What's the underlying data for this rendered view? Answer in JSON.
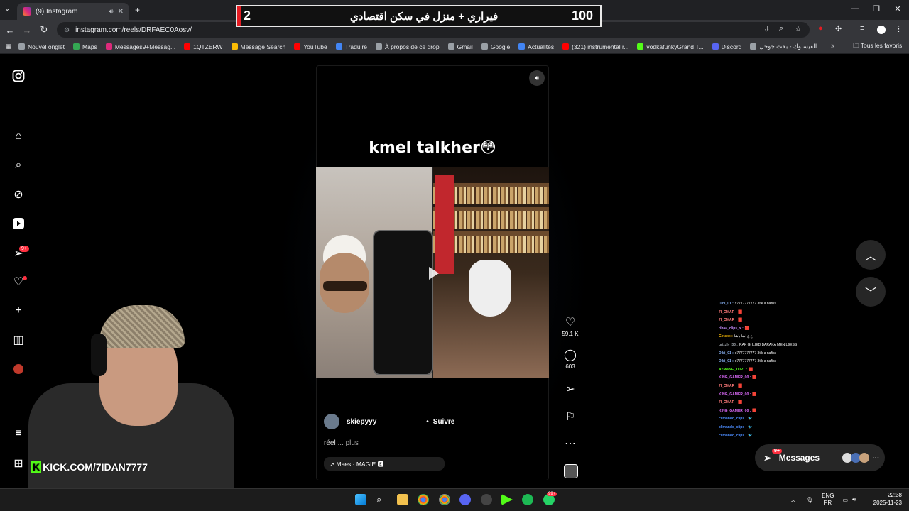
{
  "browser": {
    "tab_title": "(9) Instagram",
    "url": "instagram.com/reels/DRFAEC0Aosv/",
    "bookmarks": [
      {
        "label": "Nouvel onglet",
        "color": "#9aa0a6"
      },
      {
        "label": "Maps",
        "color": "#34a853"
      },
      {
        "label": "Messages9+Messag...",
        "color": "#dd2a7b"
      },
      {
        "label": "1QTZERW",
        "color": "#ff0000"
      },
      {
        "label": "Message Search",
        "color": "#fbbc04"
      },
      {
        "label": "YouTube",
        "color": "#ff0000"
      },
      {
        "label": "Traduire",
        "color": "#4285f4"
      },
      {
        "label": "À propos de ce drop",
        "color": "#9aa0a6"
      },
      {
        "label": "Gmail",
        "color": "#9aa0a6"
      },
      {
        "label": "Google",
        "color": "#9aa0a6"
      },
      {
        "label": "Actualités",
        "color": "#4285f4"
      },
      {
        "label": "(321) instrumental r...",
        "color": "#ff0000"
      },
      {
        "label": "vodkafunkyGrand T...",
        "color": "#53fc18"
      },
      {
        "label": "Discord",
        "color": "#5865f2"
      },
      {
        "label": "الفيسبوك - بحث جوجل",
        "color": "#9aa0a6"
      }
    ],
    "all_bookmarks": "Tous les favoris"
  },
  "banner": {
    "left_number": "2",
    "title": "فيراري + منزل في سكن اقتصادي",
    "right_number": "100"
  },
  "sidebar": {
    "notifications_badge": "9+"
  },
  "reel": {
    "caption": "kmel talkher😳",
    "likes": "59,1 K",
    "comments": "603",
    "username": "skiepyyy",
    "follow": "Suivre",
    "dot": "•",
    "desc": "réel",
    "more": "... plus",
    "music": "↗ Maes · MAGIE 🅴"
  },
  "chat": [
    {
      "user": "Dibi_01 :",
      "msg": "x7777777777 3tik a nafiss",
      "color": "#8ab4f8"
    },
    {
      "user": "7I_OMAR :",
      "msg": "🟥",
      "color": "#ff7b7b"
    },
    {
      "user": "7I_OMAR :",
      "msg": "🟥",
      "color": "#ff7b7b"
    },
    {
      "user": "rihaa_clips_x :",
      "msg": "🟥",
      "color": "#c58af9"
    },
    {
      "user": "Getaxx :",
      "msg": "ع ع اشا باشا",
      "color": "#fbbc04"
    },
    {
      "user": "grizzly_33 :",
      "msg": "RAK GHLIED BARAKA MEN L9ESS",
      "color": "#9aa0a6"
    },
    {
      "user": "Dibi_01 :",
      "msg": "x7777777777 3tik a nafiss",
      "color": "#8ab4f8"
    },
    {
      "user": "Dibi_01 :",
      "msg": "x7777777777 3tik a nafiss",
      "color": "#8ab4f8"
    },
    {
      "user": "AYMANE_TOP1 :",
      "msg": "🟥",
      "color": "#53fc18"
    },
    {
      "user": "KING_GAMER_00 :",
      "msg": "🟥",
      "color": "#e06cff"
    },
    {
      "user": "7I_OMAR :",
      "msg": "🟥",
      "color": "#ff7b7b"
    },
    {
      "user": "KING_GAMER_00 :",
      "msg": "🟥",
      "color": "#e06cff"
    },
    {
      "user": "7I_OMAR :",
      "msg": "🟥",
      "color": "#ff7b7b"
    },
    {
      "user": "KING_GAMER_00 :",
      "msg": "🟥",
      "color": "#e06cff"
    },
    {
      "user": "climando_clips :",
      "msg": "🐦",
      "color": "#4d8dff"
    },
    {
      "user": "climando_clips :",
      "msg": "🐦",
      "color": "#4d8dff"
    },
    {
      "user": "climando_clips :",
      "msg": "🐦",
      "color": "#4d8dff"
    }
  ],
  "messages": {
    "label": "Messages",
    "badge": "9+"
  },
  "stream": {
    "kick_handle": "KICK.COM/7IDAN7777",
    "kick_logo": "K"
  },
  "taskbar": {
    "lang_top": "ENG",
    "lang_bottom": "FR",
    "time": "22:38",
    "date": "2025-11-23",
    "whatsapp_badge": "99+"
  },
  "colors": {
    "accent_like": "#ff3040",
    "kick_green": "#53fc18",
    "banner_red": "#e51c23"
  }
}
